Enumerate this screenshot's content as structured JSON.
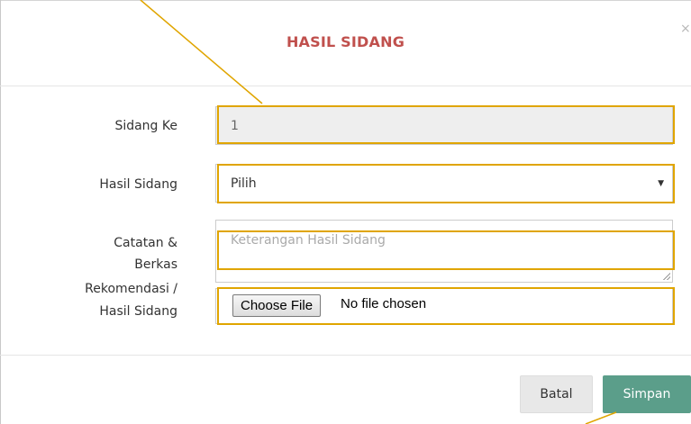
{
  "modal": {
    "title": "HASIL SIDANG",
    "close_icon": "×"
  },
  "form": {
    "sidang_ke": {
      "label": "Sidang Ke",
      "value": "1"
    },
    "hasil_sidang": {
      "label": "Hasil Sidang",
      "selected": "Pilih"
    },
    "catatan": {
      "label_lines": [
        "Catatan &",
        "Berkas",
        "Rekomendasi /",
        "Hasil Sidang"
      ],
      "placeholder": "Keterangan Hasil Sidang",
      "file_button": "Choose File",
      "file_status": "No file chosen"
    }
  },
  "footer": {
    "cancel_label": "Batal",
    "save_label": "Simpan"
  },
  "colors": {
    "title": "#c0504d",
    "highlight": "#e0a500",
    "save_button": "#5b9e8a"
  },
  "icons": {
    "close": "close-icon",
    "dropdown": "caret-down-icon"
  }
}
